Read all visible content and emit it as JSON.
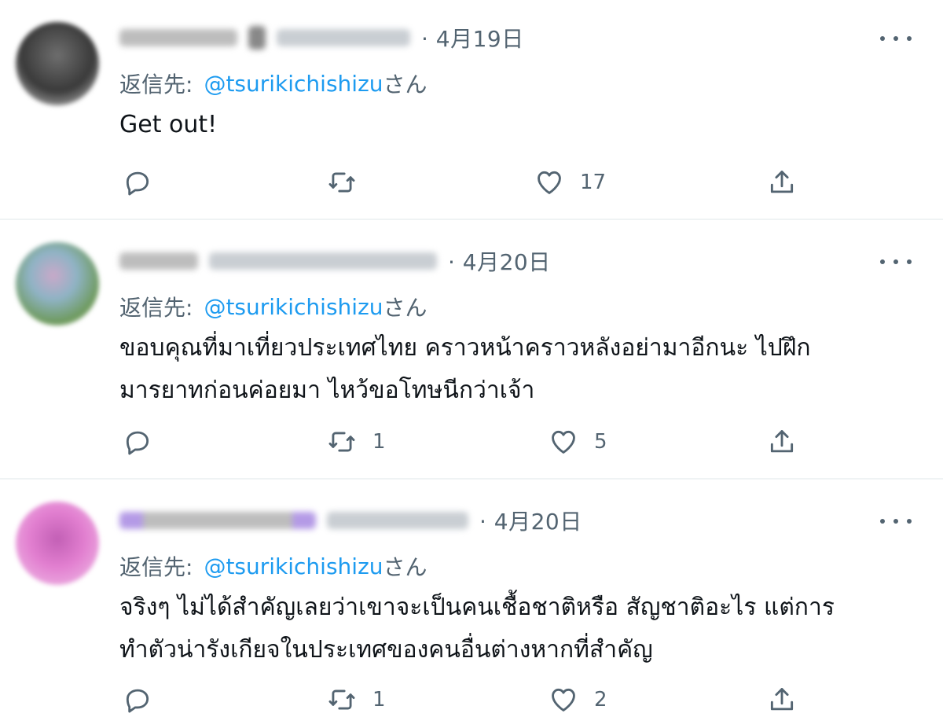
{
  "tweets": [
    {
      "date": "· 4月19日",
      "reply_prefix": "返信先:",
      "mention": "@tsurikichishizu",
      "mention_suffix": "さん",
      "text_lines": [
        "Get out!"
      ],
      "retweets": "",
      "likes": "17",
      "avatar_color": "#3a3a3a"
    },
    {
      "date": "· 4月20日",
      "reply_prefix": "返信先:",
      "mention": "@tsurikichishizu",
      "mention_suffix": "さん",
      "text_lines": [
        "ขอบคุณที่มาเที่ยวประเทศไทย คราวหน้าคราวหลังอย่ามาอีกนะ ไปฝึก",
        "มารยาทก่อนค่อยมา ไหว้ขอโทษนีกว่าเจ้า"
      ],
      "retweets": "1",
      "likes": "5",
      "avatar_color": "#7fa6b8"
    },
    {
      "date": "· 4月20日",
      "reply_prefix": "返信先:",
      "mention": "@tsurikichishizu",
      "mention_suffix": "さん",
      "text_lines": [
        "จริงๆ ไม่ได้สำคัญเลยว่าเขาจะเป็นคนเชื้อชาติหรือ สัญชาติอะไร แต่การ",
        "ทำตัวน่ารังเกียจในประเทศของคนอื่นต่างหากที่สำคัญ"
      ],
      "retweets": "1",
      "likes": "2",
      "avatar_color": "#e27fd0"
    }
  ],
  "icons": {
    "reply": "reply-icon",
    "retweet": "retweet-icon",
    "like": "heart-icon",
    "share": "share-icon",
    "more": "more-icon"
  }
}
